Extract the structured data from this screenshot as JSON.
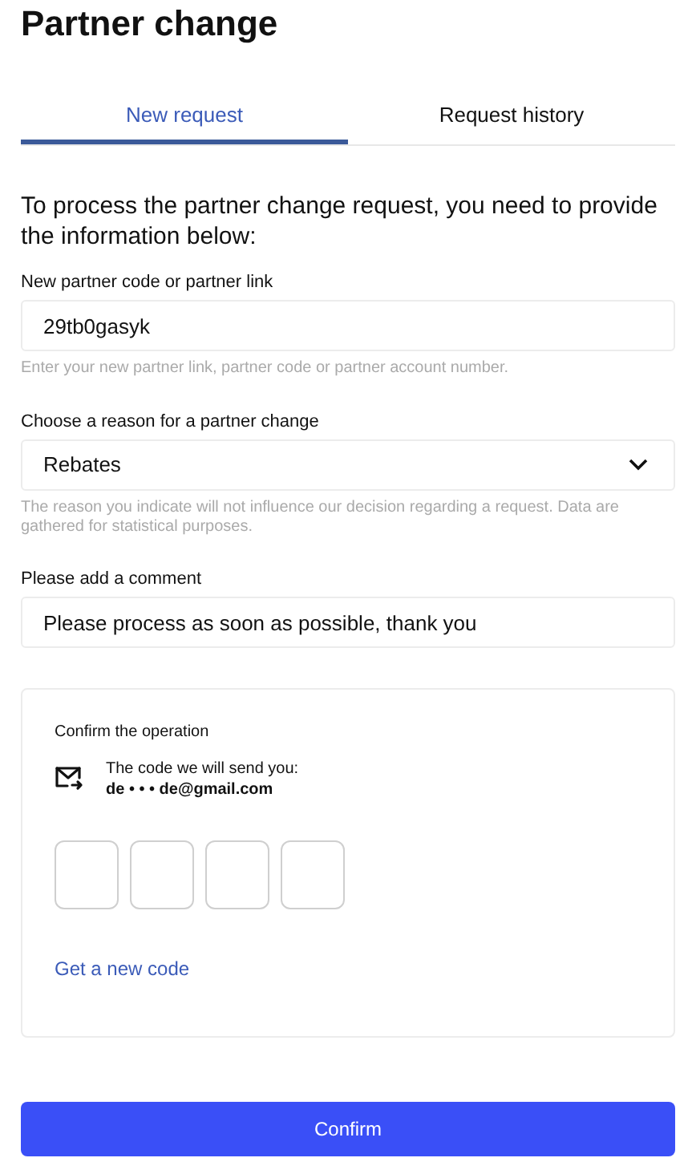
{
  "title": "Partner change",
  "tabs": [
    {
      "label": "New request",
      "selected": true
    },
    {
      "label": "Request history",
      "selected": false
    }
  ],
  "intro": "To process the partner change request, you need to provide the information below:",
  "fields": [
    {
      "kind": "text",
      "label": "New partner code or partner link",
      "value": "29tb0gasyk",
      "hint": "Enter your new partner link, partner code or partner account number."
    },
    {
      "kind": "select",
      "label": "Choose a reason for a partner change",
      "value": "Rebates",
      "hint": "The reason you indicate will not influence our decision regarding a request. Data are gathered for statistical purposes."
    },
    {
      "kind": "text",
      "label": "Please add a comment",
      "value": "Please process as soon as possible, thank you"
    }
  ],
  "confirmation": {
    "title": "Confirm the operation",
    "send_note": "The code we will send you:",
    "email": "de • • • de@gmail.com",
    "code_digits": [
      {
        "filled": false
      },
      {
        "filled": false
      },
      {
        "filled": false
      },
      {
        "filled": false
      }
    ],
    "resend_link": "Get a new code"
  },
  "submit_button": "Confirm"
}
